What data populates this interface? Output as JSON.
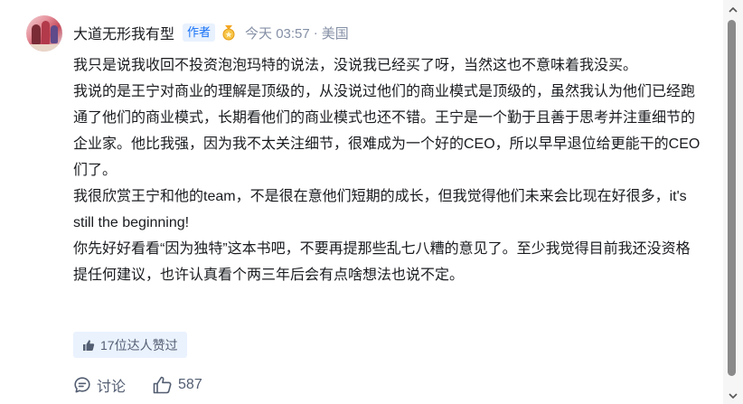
{
  "author": {
    "name": "大道无形我有型",
    "badge": "作者",
    "time": "今天 03:57",
    "separator": "·",
    "location": "美国"
  },
  "comment": {
    "paragraphs": [
      "我只是说我收回不投资泡泡玛特的说法，没说我已经买了呀，当然这也不意味着我没买。",
      "我说的是王宁对商业的理解是顶级的，从没说过他们的商业模式是顶级的，虽然我认为他们已经跑通了他们的商业模式，长期看他们的商业模式也还不错。王宁是一个勤于且善于思考并注重细节的企业家。他比我强，因为我不太关注细节，很难成为一个好的CEO，所以早早退位给更能干的CEO们了。",
      "我很欣赏王宁和他的team，不是很在意他们短期的成长，但我觉得他们未来会比现在好很多，it's still the beginning!",
      "你先好好看看“因为独特”这本书吧，不要再提那些乱七八糟的意见了。至少我觉得目前我还没资格提任何建议，也许认真看个两三年后会有点啥想法也说不定。"
    ]
  },
  "endorsement": {
    "label": "17位达人赞过"
  },
  "actions": {
    "reply_label": "讨论",
    "like_count": "587"
  },
  "colors": {
    "accent": "#1772f6",
    "muted": "#8590a6",
    "text": "#191b1f"
  },
  "icons": [
    "thumbs-up-icon",
    "comment-bubble-icon",
    "like-outline-icon",
    "medal-icon",
    "scroll-up-arrow-icon",
    "scroll-down-arrow-icon"
  ]
}
